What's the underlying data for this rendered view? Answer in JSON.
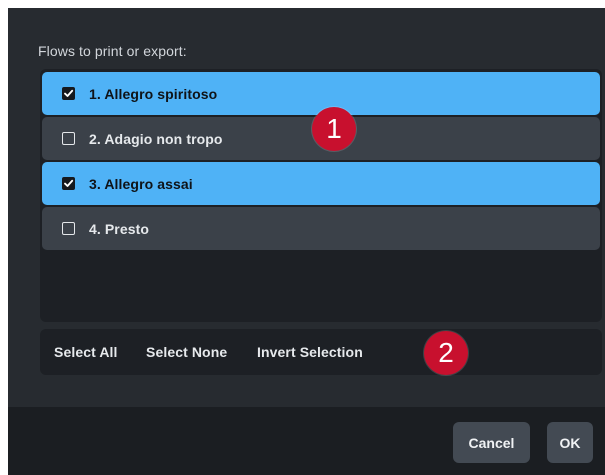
{
  "dialog": {
    "section_label": "Flows to print or export:",
    "flows": [
      {
        "label": "1. Allegro spiritoso",
        "checked": true
      },
      {
        "label": "2. Adagio non tropo",
        "checked": false
      },
      {
        "label": "3. Allegro assai",
        "checked": true
      },
      {
        "label": "4. Presto",
        "checked": false
      }
    ],
    "selection_actions": {
      "select_all": "Select All",
      "select_none": "Select None",
      "invert_selection": "Invert Selection"
    },
    "callouts": {
      "first": "1",
      "second": "2"
    },
    "footer": {
      "cancel_label": "Cancel",
      "ok_label": "OK"
    }
  },
  "colors": {
    "dialog_background": "#272b30",
    "panel_background": "#1d2025",
    "row_selected": "#4fb2f6",
    "row_unselected": "#3b4149",
    "callout": "#c8102e",
    "footer_background": "#1b1e22",
    "footer_button": "#434a53"
  },
  "icons": {
    "checked": "checkbox-checked-icon",
    "unchecked": "checkbox-unchecked-icon"
  }
}
